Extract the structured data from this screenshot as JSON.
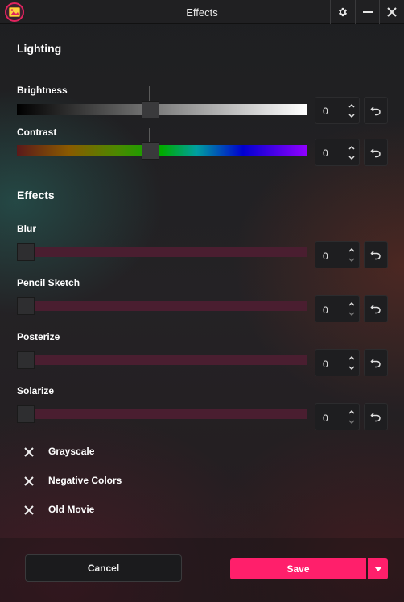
{
  "window": {
    "title": "Effects",
    "accent": "#ff1f6b",
    "icons": [
      "app-logo-icon",
      "gear-icon",
      "minimize-icon",
      "close-icon"
    ]
  },
  "lighting": {
    "title": "Lighting",
    "brightness": {
      "label": "Brightness",
      "value": "0",
      "slider_fraction": 0.5
    },
    "contrast": {
      "label": "Contrast",
      "value": "0",
      "slider_fraction": 0.5
    }
  },
  "effects": {
    "title": "Effects",
    "sliders": [
      {
        "label": "Blur",
        "value": "0",
        "slider_fraction": 0
      },
      {
        "label": "Pencil Sketch",
        "value": "0",
        "slider_fraction": 0
      },
      {
        "label": "Posterize",
        "value": "0",
        "slider_fraction": 0
      },
      {
        "label": "Solarize",
        "value": "0",
        "slider_fraction": 0
      }
    ],
    "toggles": [
      {
        "label": "Grayscale",
        "checked": false
      },
      {
        "label": "Negative Colors",
        "checked": false
      },
      {
        "label": "Old Movie",
        "checked": false
      }
    ]
  },
  "footer": {
    "cancel_label": "Cancel",
    "save_label": "Save"
  }
}
